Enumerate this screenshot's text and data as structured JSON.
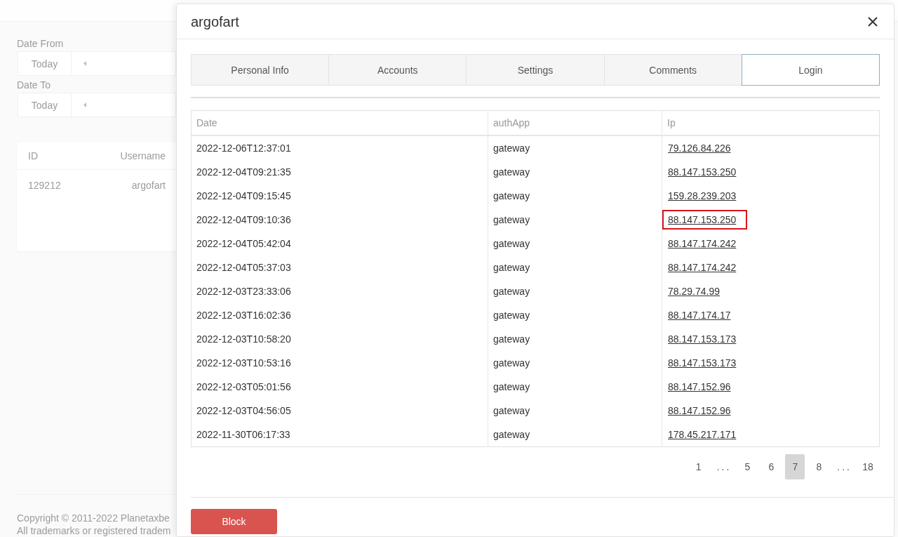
{
  "background_page": {
    "date_filters": [
      {
        "label": "Date From",
        "today_button": "Today"
      },
      {
        "label": "Date To",
        "today_button": "Today"
      }
    ],
    "users_table": {
      "columns": [
        "ID",
        "Username"
      ],
      "rows": [
        [
          "129212",
          "argofart"
        ]
      ]
    },
    "footer": [
      "Copyright © 2011-2022 Planetaxbe",
      "All trademarks or registered tradem"
    ]
  },
  "dialog": {
    "title": "argofart",
    "tabs": [
      {
        "label": "Personal Info",
        "selected": false
      },
      {
        "label": "Accounts",
        "selected": false
      },
      {
        "label": "Settings",
        "selected": false
      },
      {
        "label": "Comments",
        "selected": false
      },
      {
        "label": "Login",
        "selected": true
      }
    ],
    "login_table": {
      "columns": [
        "Date",
        "authApp",
        "Ip"
      ],
      "rows": [
        {
          "date": "2022-12-06T12:37:01",
          "auth_app": "gateway",
          "ip": "79.126.84.226",
          "highlighted": false
        },
        {
          "date": "2022-12-04T09:21:35",
          "auth_app": "gateway",
          "ip": "88.147.153.250",
          "highlighted": false
        },
        {
          "date": "2022-12-04T09:15:45",
          "auth_app": "gateway",
          "ip": "159.28.239.203",
          "highlighted": false
        },
        {
          "date": "2022-12-04T09:10:36",
          "auth_app": "gateway",
          "ip": "88.147.153.250",
          "highlighted": true
        },
        {
          "date": "2022-12-04T05:42:04",
          "auth_app": "gateway",
          "ip": "88.147.174.242",
          "highlighted": false
        },
        {
          "date": "2022-12-04T05:37:03",
          "auth_app": "gateway",
          "ip": "88.147.174.242",
          "highlighted": false
        },
        {
          "date": "2022-12-03T23:33:06",
          "auth_app": "gateway",
          "ip": "78.29.74.99",
          "highlighted": false
        },
        {
          "date": "2022-12-03T16:02:36",
          "auth_app": "gateway",
          "ip": "88.147.174.17",
          "highlighted": false
        },
        {
          "date": "2022-12-03T10:58:20",
          "auth_app": "gateway",
          "ip": "88.147.153.173",
          "highlighted": false
        },
        {
          "date": "2022-12-03T10:53:16",
          "auth_app": "gateway",
          "ip": "88.147.153.173",
          "highlighted": false
        },
        {
          "date": "2022-12-03T05:01:56",
          "auth_app": "gateway",
          "ip": "88.147.152.96",
          "highlighted": false
        },
        {
          "date": "2022-12-03T04:56:05",
          "auth_app": "gateway",
          "ip": "88.147.152.96",
          "highlighted": false
        },
        {
          "date": "2022-11-30T06:17:33",
          "auth_app": "gateway",
          "ip": "178.45.217.171",
          "highlighted": false
        }
      ]
    },
    "pagination": [
      {
        "kind": "page",
        "label": "1",
        "selected": false
      },
      {
        "kind": "ellipsis",
        "label": "..."
      },
      {
        "kind": "page",
        "label": "5",
        "selected": false
      },
      {
        "kind": "page",
        "label": "6",
        "selected": false
      },
      {
        "kind": "page",
        "label": "7",
        "selected": true
      },
      {
        "kind": "page",
        "label": "8",
        "selected": false
      },
      {
        "kind": "ellipsis",
        "label": "..."
      },
      {
        "kind": "page",
        "label": "18",
        "selected": false
      }
    ],
    "buttons": [
      {
        "label": "Block"
      }
    ]
  }
}
